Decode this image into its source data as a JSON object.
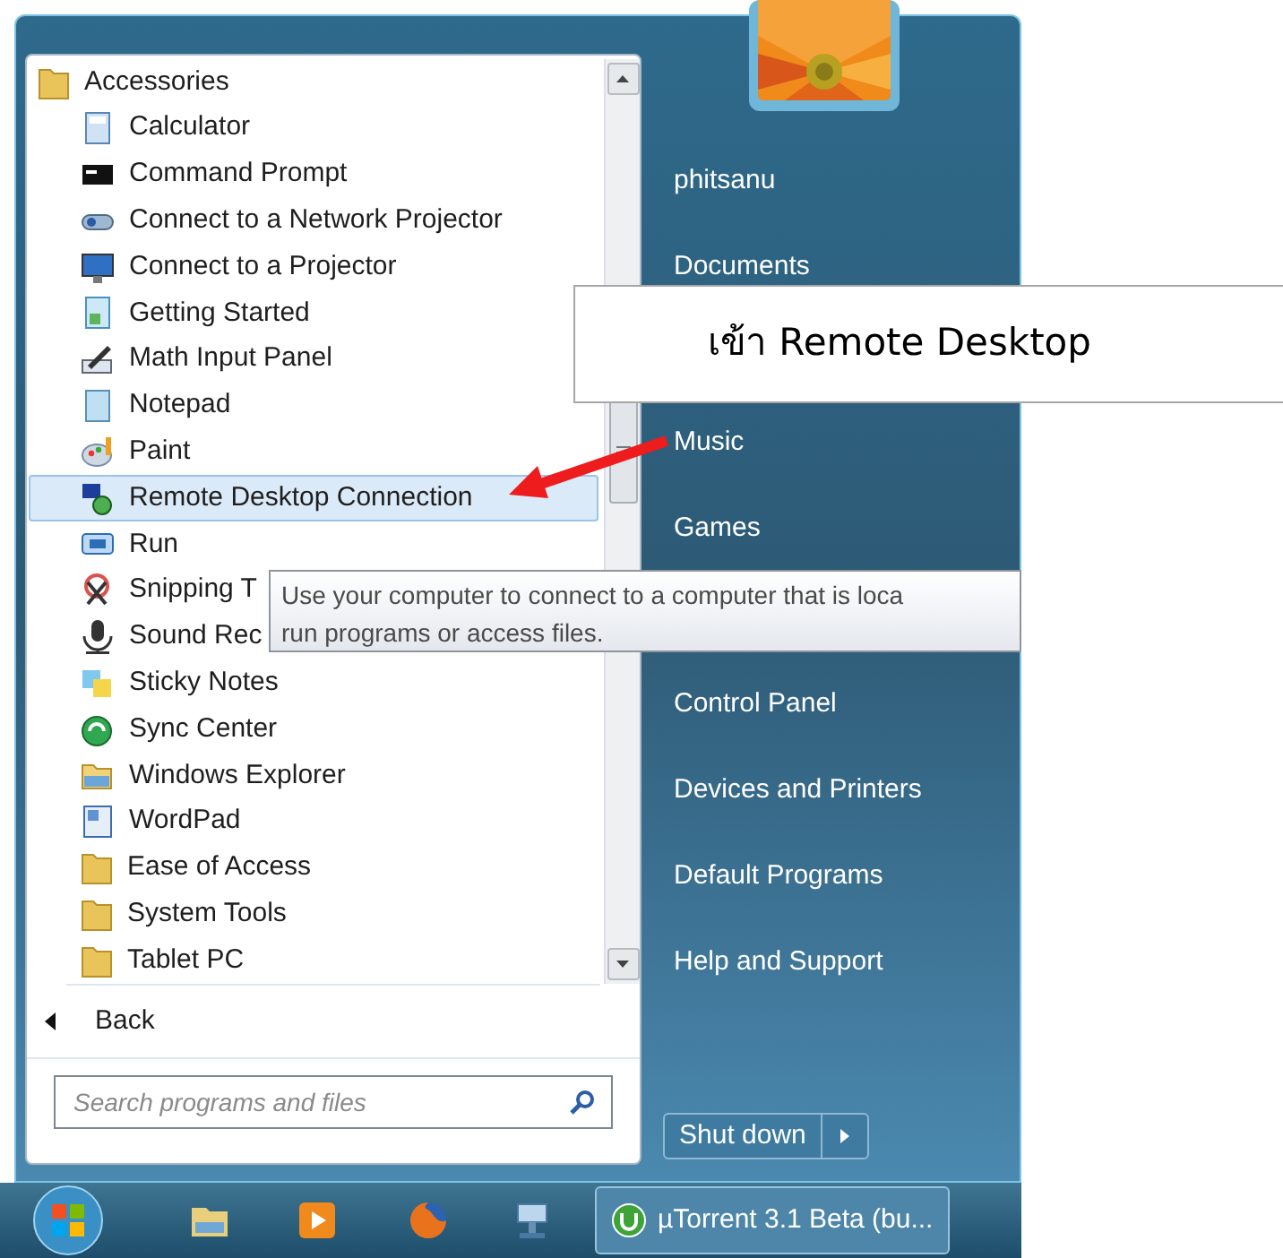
{
  "programs": {
    "items": [
      {
        "label": "Accessories",
        "kind": "folder",
        "selected": false,
        "children": [
          {
            "label": "Calculator",
            "kind": "program",
            "selected": false
          },
          {
            "label": "Command Prompt",
            "kind": "program",
            "selected": false
          },
          {
            "label": "Connect to a Network Projector",
            "kind": "program",
            "selected": false
          },
          {
            "label": "Connect to a Projector",
            "kind": "program",
            "selected": false
          },
          {
            "label": "Getting Started",
            "kind": "program",
            "selected": false
          },
          {
            "label": "Math Input Panel",
            "kind": "program",
            "selected": false
          },
          {
            "label": "Notepad",
            "kind": "program",
            "selected": false
          },
          {
            "label": "Paint",
            "kind": "program",
            "selected": false
          },
          {
            "label": "Remote Desktop Connection",
            "kind": "program",
            "selected": true
          },
          {
            "label": "Run",
            "kind": "program",
            "selected": false
          },
          {
            "label": "Snipping T",
            "kind": "program",
            "selected": false
          },
          {
            "label": "Sound Rec",
            "kind": "program",
            "selected": false
          },
          {
            "label": "Sticky Notes",
            "kind": "program",
            "selected": false
          },
          {
            "label": "Sync Center",
            "kind": "program",
            "selected": false
          },
          {
            "label": "Windows Explorer",
            "kind": "program",
            "selected": false
          },
          {
            "label": "WordPad",
            "kind": "program",
            "selected": false
          },
          {
            "label": "Ease of Access",
            "kind": "folder",
            "selected": false
          },
          {
            "label": "System Tools",
            "kind": "folder",
            "selected": false
          },
          {
            "label": "Tablet PC",
            "kind": "folder",
            "selected": false
          }
        ]
      }
    ]
  },
  "back": {
    "label": "Back"
  },
  "search": {
    "placeholder": "Search programs and files"
  },
  "right_links": [
    [
      "phitsanu",
      "Documents"
    ],
    [
      "Music",
      "Games"
    ],
    [
      "Control Panel",
      "Devices and Printers",
      "Default Programs",
      "Help and Support"
    ]
  ],
  "shutdown": {
    "label": "Shut down"
  },
  "tooltip": {
    "lines": [
      "Use your computer to connect to a computer that is loca",
      "run programs or access files."
    ]
  },
  "callout": {
    "text": "เข้า Remote Desktop"
  },
  "taskbar": {
    "tasks": [
      {
        "label": "µTorrent 3.1 Beta (bu..."
      }
    ]
  }
}
